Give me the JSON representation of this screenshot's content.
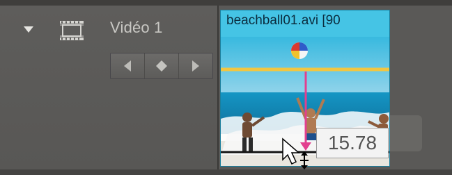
{
  "track": {
    "name": "Vidéo 1",
    "collapse_icon": "triangle-down-icon",
    "type_icon": "film-strip-icon",
    "keyframe_nav": {
      "prev_icon": "triangle-left-icon",
      "add_icon": "diamond-icon",
      "next_icon": "triangle-right-icon"
    }
  },
  "clip": {
    "title": "beachball01.avi [90",
    "color": "#2fb4d7",
    "title_bar_color": "#45c4e5",
    "opacity_line_color": "#f2c641",
    "drag_line_color": "#e2408f"
  },
  "tooltip": {
    "value": "15.78"
  },
  "cursor": {
    "icon": "vertical-resize-cursor-icon"
  }
}
